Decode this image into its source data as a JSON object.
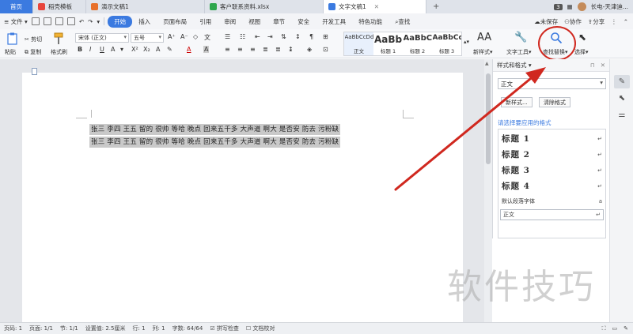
{
  "tabs": {
    "home": "首页",
    "items": [
      {
        "label": "稻壳模板",
        "color": "#e8453c"
      },
      {
        "label": "演示文稿1",
        "color": "#e8702a"
      },
      {
        "label": "客户联系资料.xlsx",
        "color": "#2ea64d"
      },
      {
        "label": "文字文稿1",
        "color": "#3b7ae0"
      }
    ],
    "add": "+",
    "badge": "3",
    "user": "长电-天津迪..."
  },
  "menu": {
    "file": "≡ 文件 ▾",
    "items": [
      "开始",
      "插入",
      "页面布局",
      "引用",
      "审阅",
      "视图",
      "章节",
      "安全",
      "开发工具",
      "特色功能"
    ],
    "active_index": 0,
    "search": "查找",
    "unsaved": "未保存",
    "collab": "协作",
    "share": "分享"
  },
  "ribbon": {
    "paste": "粘贴",
    "cut": "剪切",
    "copy": "复制",
    "format_painter": "格式刷",
    "font_name": "宋体 (正文)",
    "font_size": "五号",
    "styles": [
      {
        "sample": "AaBbCcDd",
        "label": "正文"
      },
      {
        "sample": "AaBb",
        "label": "标题 1"
      },
      {
        "sample": "AaBbC",
        "label": "标题 2"
      },
      {
        "sample": "AaBbCc",
        "label": "标题 3"
      }
    ],
    "new_style": "新样式",
    "text_tools": "文字工具",
    "find_replace": "查找替换",
    "select": "选择"
  },
  "document": {
    "lines": [
      "张三  李四  王五  留的  很帅    等哈  晚点  回来五千多  大声道  啊大  是否安  防去  污粉缺",
      "张三  李四  王五  留的  很帅    等哈  晚点  回来五千多  大声道  啊大  是否安  防去  污粉缺"
    ]
  },
  "pane": {
    "title": "样式和格式",
    "current_style": "正文",
    "new_style_btn": "新样式...",
    "clear_format_btn": "清除格式",
    "apply_label": "请选择要应用的格式",
    "styles": [
      {
        "label": "标题  1",
        "kind": "heading"
      },
      {
        "label": "标题  2",
        "kind": "heading"
      },
      {
        "label": "标题  3",
        "kind": "heading"
      },
      {
        "label": "标题  4",
        "kind": "heading"
      },
      {
        "label": "默认段落字体",
        "kind": "small"
      },
      {
        "label": "正文",
        "kind": "selected"
      }
    ],
    "return_mark": "↵",
    "para_mark": "a"
  },
  "status": {
    "page_num": "页码: 1",
    "page": "页面: 1/1",
    "section": "节: 1/1",
    "setting": "设置值: 2.5厘米",
    "row": "行: 1",
    "col": "列: 1",
    "word_count": "字数: 64/64",
    "spell": "拼写检查",
    "proofread": "文档校对"
  },
  "watermark": "软件技巧",
  "colors": {
    "accent": "#3b7ae0",
    "annotation": "#d0281f",
    "selection": "#c9c9c9"
  }
}
